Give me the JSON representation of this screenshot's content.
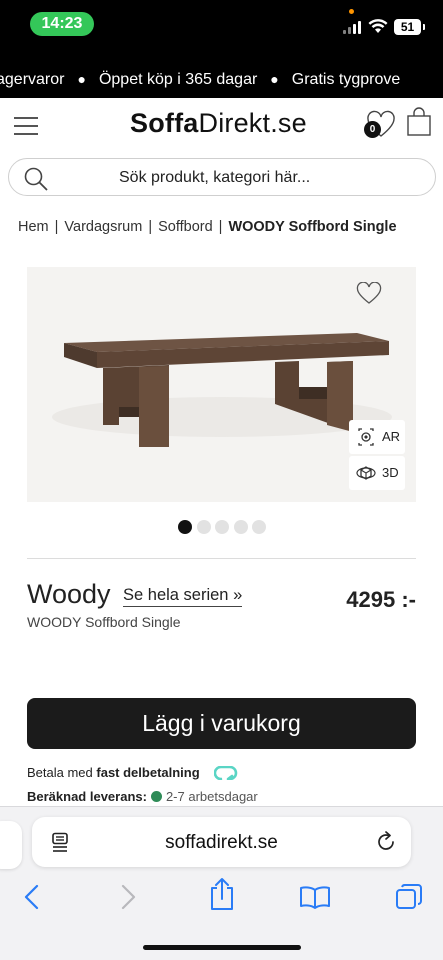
{
  "status_bar": {
    "time": "14:23",
    "battery": "51"
  },
  "ticker": {
    "items": [
      "agervaror",
      "Öppet köp i 365 dagar",
      "Gratis tygprove"
    ]
  },
  "header": {
    "logo_bold": "Soffa",
    "logo_regular": "Direkt.se",
    "wishlist_count": "0"
  },
  "search": {
    "placeholder": "Sök produkt, kategori här..."
  },
  "breadcrumb": {
    "items": [
      "Hem",
      "Vardagsrum",
      "Soffbord"
    ],
    "current": "WOODY Soffbord Single",
    "separator": "|"
  },
  "gallery": {
    "ar_label": "AR",
    "view3d_label": "3D",
    "dot_count": 5,
    "active_dot": 0
  },
  "product": {
    "name": "Woody",
    "series_link": "Se hela serien »",
    "price": "4295 :-",
    "subtitle": "WOODY Soffbord Single"
  },
  "actions": {
    "add_to_cart": "Lägg i varukorg"
  },
  "payment": {
    "prefix": "Betala med",
    "bold": "fast delbetalning"
  },
  "delivery": {
    "label": "Beräknad leverans:",
    "days": "2-7 arbetsdagar",
    "status_color": "#2e8b57"
  },
  "browser": {
    "url": "soffadirekt.se"
  },
  "colors": {
    "button": "#1b1b1b",
    "accent_green": "#34c759",
    "payment_logo": "#5ad5c5"
  }
}
